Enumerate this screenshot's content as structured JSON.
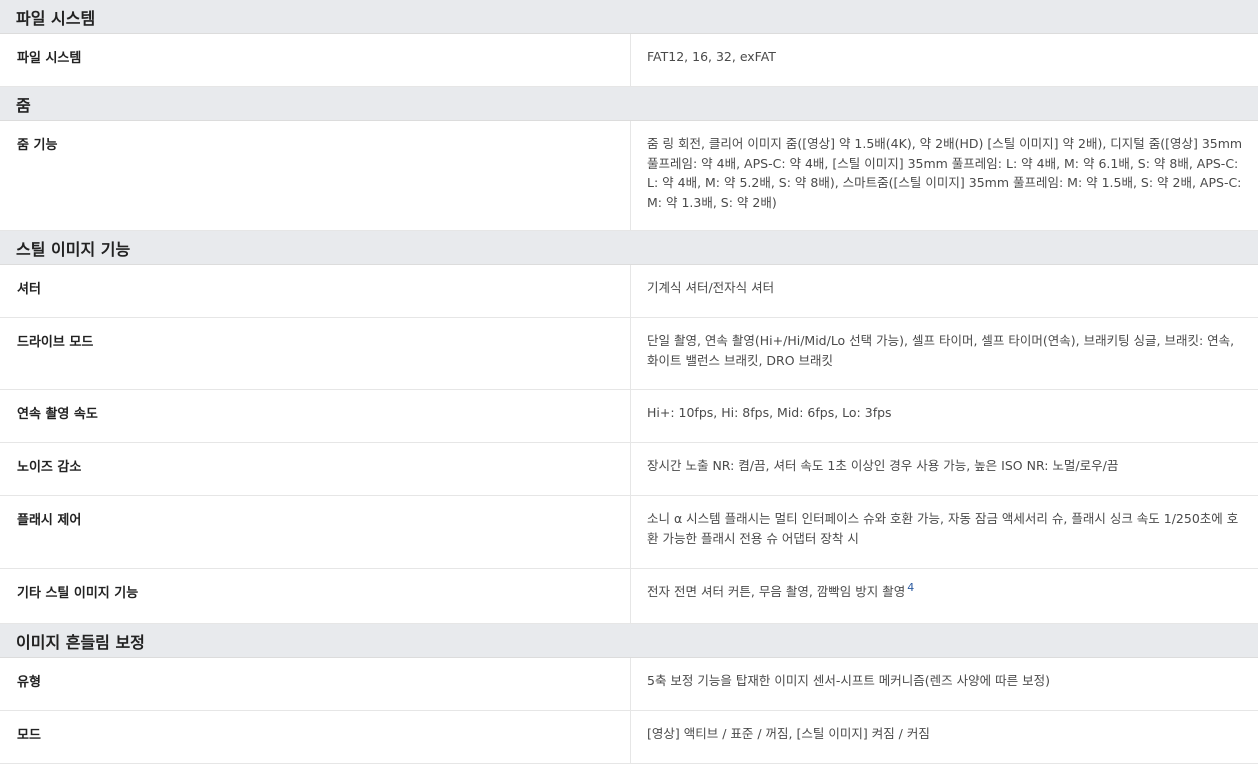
{
  "sections": [
    {
      "title": "파일 시스템",
      "rows": [
        {
          "label": "파일 시스템",
          "value": "FAT12, 16, 32, exFAT"
        }
      ]
    },
    {
      "title": "줌",
      "rows": [
        {
          "label": "줌 기능",
          "value": "줌 링 회전, 클리어 이미지 줌([영상] 약 1.5배(4K), 약 2배(HD) [스틸 이미지] 약 2배), 디지털 줌([영상] 35mm 풀프레임: 약 4배, APS-C: 약 4배, [스틸 이미지] 35mm 풀프레임: L: 약 4배, M: 약 6.1배, S: 약 8배, APS-C: L: 약 4배, M: 약 5.2배, S: 약 8배), 스마트줌([스틸 이미지] 35mm 풀프레임: M: 약 1.5배, S: 약 2배, APS-C: M: 약 1.3배, S: 약 2배)"
        }
      ]
    },
    {
      "title": "스틸 이미지 기능",
      "rows": [
        {
          "label": "셔터",
          "value": "기계식 셔터/전자식 셔터"
        },
        {
          "label": "드라이브 모드",
          "value": "단일 촬영, 연속 촬영(Hi+/Hi/Mid/Lo 선택 가능), 셀프 타이머, 셀프 타이머(연속), 브래키팅 싱글, 브래킷: 연속, 화이트 밸런스 브래킷, DRO 브래킷"
        },
        {
          "label": "연속 촬영 속도",
          "value": "Hi+: 10fps, Hi: 8fps, Mid: 6fps, Lo: 3fps"
        },
        {
          "label": "노이즈 감소",
          "value": "장시간 노출 NR: 켬/끔, 셔터 속도 1초 이상인 경우 사용 가능, 높은 ISO NR: 노멀/로우/끔"
        },
        {
          "label": "플래시 제어",
          "value": "소니 α 시스템 플래시는 멀티 인터페이스 슈와 호환 가능, 자동 잠금 액세서리 슈, 플래시 싱크 속도 1/250초에 호환 가능한 플래시 전용 슈 어댑터 장착 시"
        },
        {
          "label": "기타 스틸 이미지 기능",
          "value": "전자 전면 셔터 커튼, 무음 촬영, 깜빡임 방지 촬영",
          "footnote": "4"
        }
      ]
    },
    {
      "title": "이미지 흔들림 보정",
      "rows": [
        {
          "label": "유형",
          "value": "5축 보정 기능을 탑재한 이미지 센서-시프트 메커니즘(렌즈 사양에 따른 보정)"
        },
        {
          "label": "모드",
          "value": "[영상] 액티브 / 표준 / 꺼짐, [스틸 이미지] 켜짐 / 커짐"
        }
      ]
    }
  ]
}
